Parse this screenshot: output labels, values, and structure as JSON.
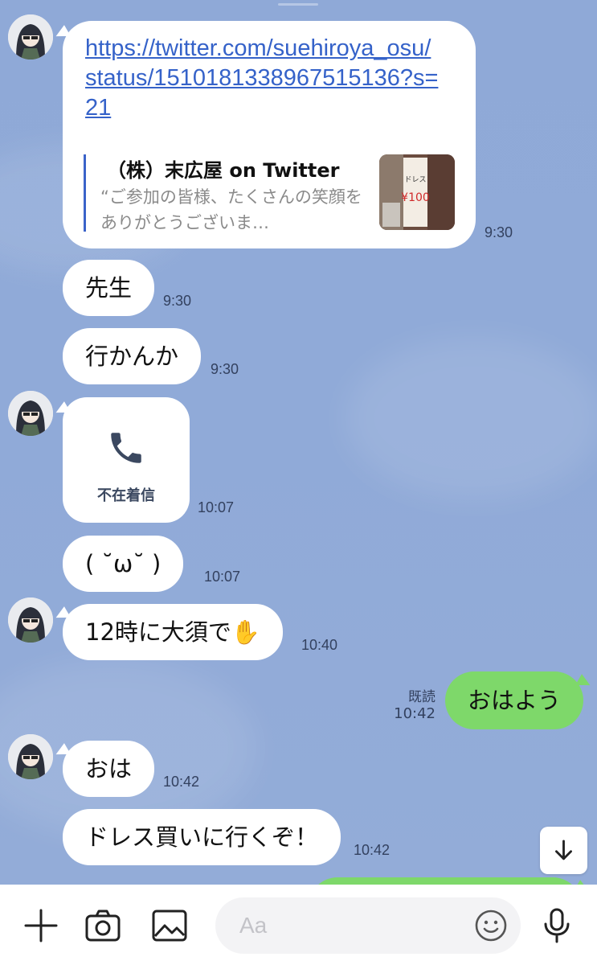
{
  "link_message": {
    "url": "https://twitter.com/suehiroya_osu/status/1510181338967515136?s=21",
    "preview_title": "（株）末広屋 on Twitter",
    "preview_desc": "“ご参加の皆様、たくさんの笑顔をありがとうございま…",
    "time": "9:30"
  },
  "messages": [
    {
      "text": "先生",
      "time": "9:30"
    },
    {
      "text": "行かんか",
      "time": "9:30"
    },
    {
      "text": "( ˘ω˘ )",
      "time": "10:07"
    },
    {
      "text": "12時に大須で✋",
      "time": "10:40"
    },
    {
      "text": "おは",
      "time": "10:42"
    },
    {
      "text": "ドレス買いに行くぞ！",
      "time": "10:42"
    }
  ],
  "missed_call": {
    "label": "不在着信",
    "time": "10:07"
  },
  "outgoing": {
    "text": "おはよう",
    "read_label": "既読",
    "time": "10:42"
  },
  "input": {
    "placeholder": "Aa"
  },
  "colors": {
    "background": "#8ea8d6",
    "outgoing_bubble": "#7ed86a",
    "link": "#3562c9"
  }
}
